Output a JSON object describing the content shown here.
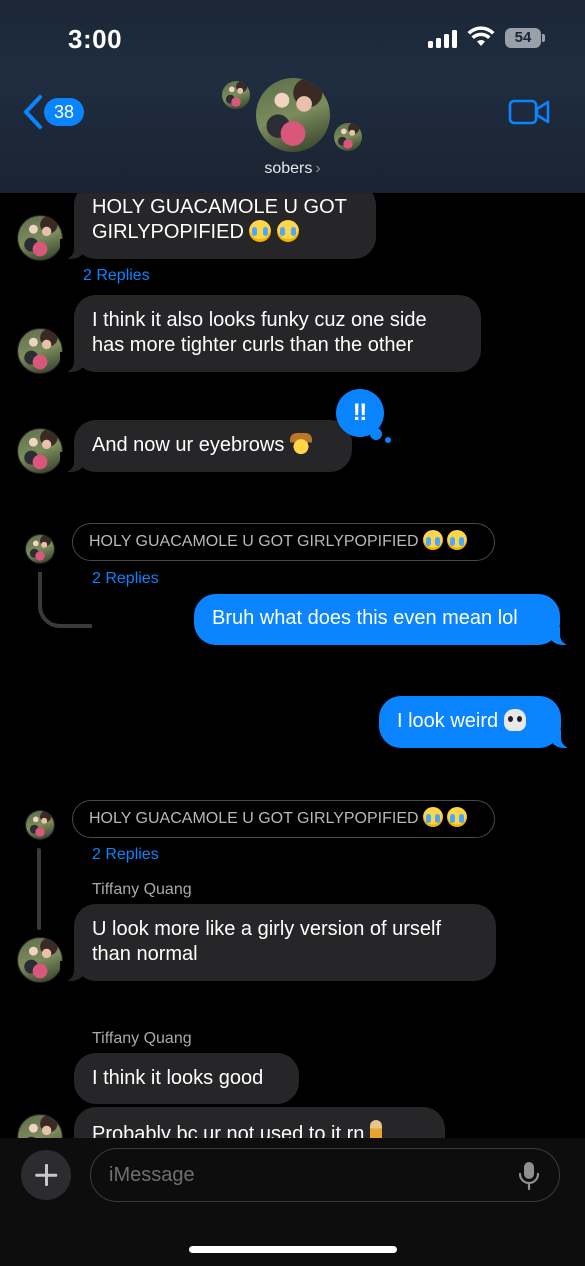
{
  "status_bar": {
    "time": "3:00",
    "battery": "54"
  },
  "header": {
    "back_count": "38",
    "group_name": "sobers",
    "chevron": "›"
  },
  "messages": [
    {
      "type": "in",
      "text": "HOLY GUACAMOLE U GOT GIRLYPOPIFIED",
      "emojis": [
        "loudly-crying-face",
        "loudly-crying-face"
      ],
      "replies": "2 Replies"
    },
    {
      "type": "in",
      "text": "I think it also looks funky cuz one side has more tighter curls than the other"
    },
    {
      "type": "in",
      "text": "And now ur eyebrows",
      "emoji": "cowboy-hat-face",
      "tapback": "‼"
    },
    {
      "type": "quoted",
      "text": "HOLY GUACAMOLE U GOT GIRLYPOPIFIED",
      "replies": "2 Replies"
    },
    {
      "type": "out",
      "text": "Bruh what does this even mean lol"
    },
    {
      "type": "out",
      "text": "I look weird",
      "emoji": "skull"
    },
    {
      "type": "quoted",
      "text": "HOLY GUACAMOLE U GOT GIRLYPOPIFIED",
      "replies": "2 Replies"
    },
    {
      "type": "in",
      "sender": "Tiffany Quang",
      "text": "U look more like a girly version of urself than normal"
    },
    {
      "type": "in",
      "sender": "Tiffany Quang",
      "text": "I think it looks good"
    },
    {
      "type": "in",
      "text": "Probably bc ur not used to it rn",
      "emoji": "person-standing"
    }
  ],
  "composer": {
    "placeholder": "iMessage"
  },
  "icons": {
    "back": "chevron-left-icon",
    "video": "video-camera-icon",
    "plus": "plus-icon",
    "mic": "microphone-icon"
  },
  "colors": {
    "accent": "#0a84ff",
    "incoming_bubble": "#262628",
    "background": "#000000"
  }
}
